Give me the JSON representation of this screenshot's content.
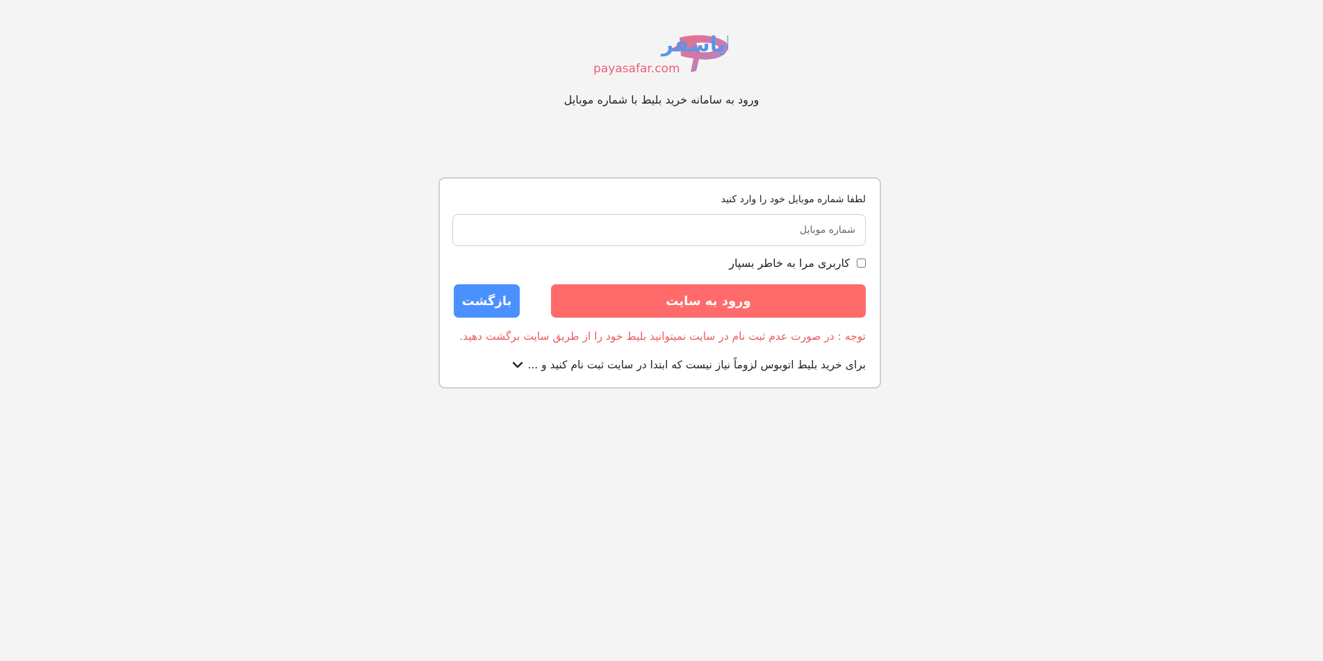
{
  "header": {
    "logo_text": "پایاسفر",
    "logo_domain": "payasafar.com",
    "subtitle": "ورود به سامانه خرید بلیط با شماره موبایل"
  },
  "form": {
    "label": "لطفا شماره موبایل خود را وارد کنید",
    "phone_placeholder": "شماره موبایل",
    "phone_value": "",
    "remember_label": "کاربری مرا به خاطر بسپار",
    "remember_checked": false,
    "login_button": "ورود به سایت",
    "back_button": "بازگشت",
    "notice": "توجه : در صورت عدم ثبت نام در سایت نمیتوانید بلیط خود را از طریق سایت برگشت دهید.",
    "info_text": "برای خرید بلیط اتوبوس لزوماً نیاز نیست که ابتدا در سایت ثبت نام کنید و ..."
  },
  "icons": {
    "logo": "payasafar-logo-icon",
    "expand": "chevron-down-icon"
  },
  "colors": {
    "background": "#f4f4f4",
    "login_button": "#ff6b6b",
    "back_button": "#4a90ff",
    "notice_text": "#ee5b5b",
    "logo_blue": "#5b95e6",
    "logo_pink": "#f05d7a"
  }
}
